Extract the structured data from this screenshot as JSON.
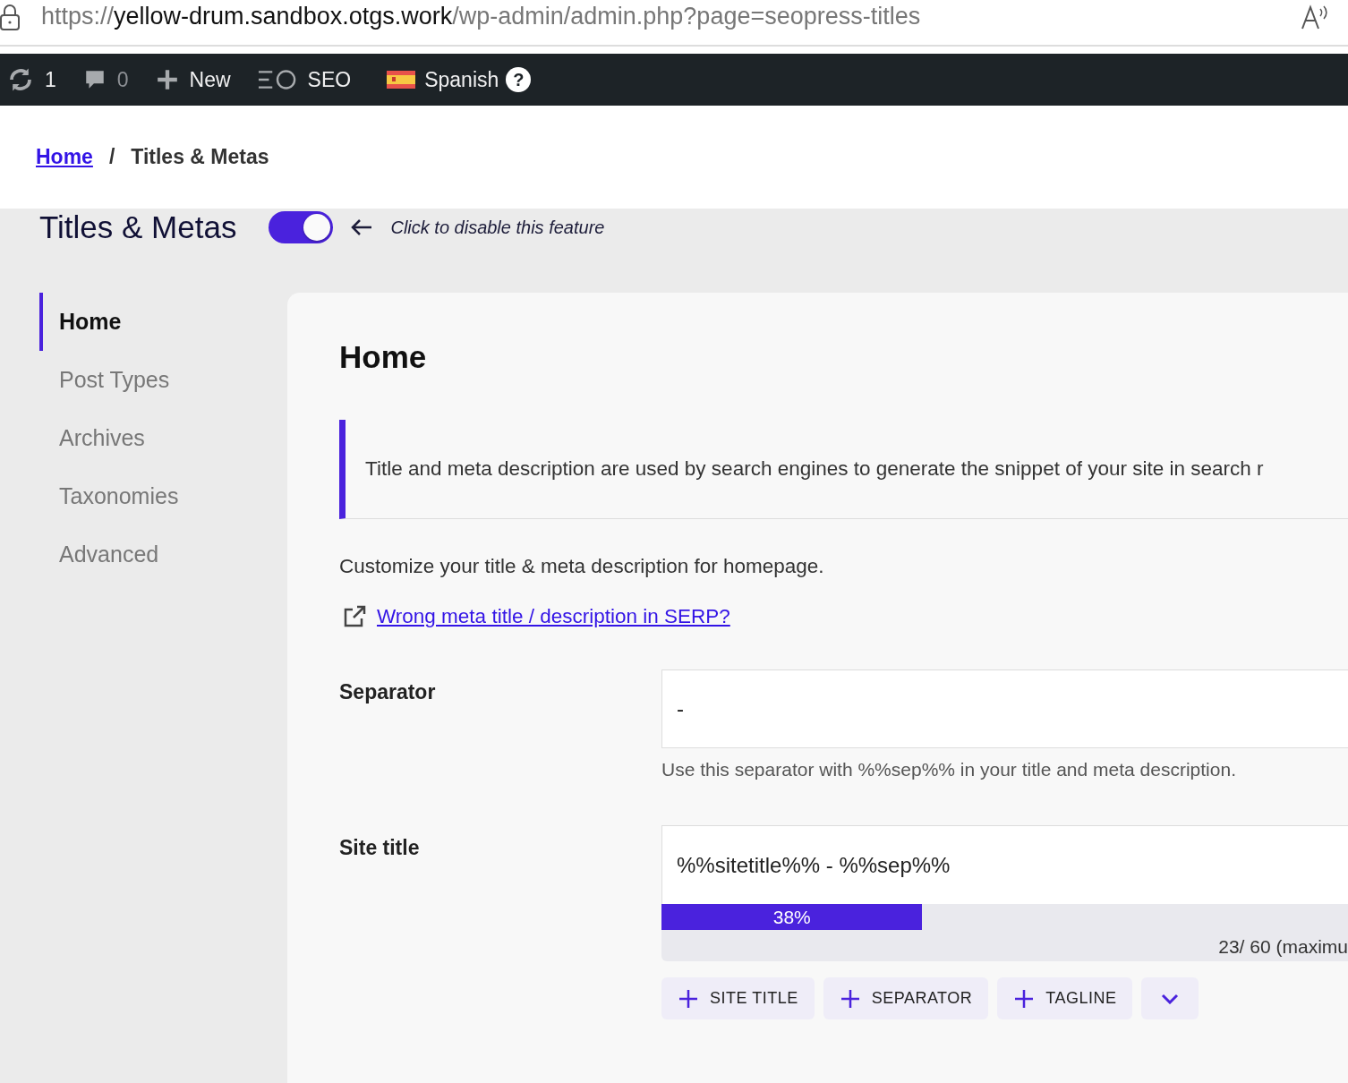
{
  "address_bar": {
    "scheme": "https://",
    "host": "yellow-drum.sandbox.otgs.work",
    "path": "/wp-admin/admin.php?page=seopress-titles"
  },
  "admin_bar": {
    "updates": "1",
    "comments": "0",
    "new": "New",
    "seo": "SEO",
    "language": "Spanish",
    "help": "?"
  },
  "breadcrumb": {
    "home": "Home",
    "separator": "/",
    "current": "Titles & Metas"
  },
  "header": {
    "title": "Titles & Metas",
    "toggle_on": true,
    "hint": "Click to disable this feature"
  },
  "sidebar": {
    "items": [
      {
        "label": "Home",
        "selected": true
      },
      {
        "label": "Post Types",
        "selected": false
      },
      {
        "label": "Archives",
        "selected": false
      },
      {
        "label": "Taxonomies",
        "selected": false
      },
      {
        "label": "Advanced",
        "selected": false
      }
    ]
  },
  "main": {
    "title": "Home",
    "notice": "Title and meta description are used by search engines to generate the snippet of your site in search r",
    "intro": "Customize your title & meta description for homepage.",
    "help_link": "Wrong meta title / description in SERP?",
    "fields": [
      {
        "kind": "separator",
        "label": "Separator",
        "value": "-",
        "help": "Use this separator with %%sep%% in your title and meta description."
      },
      {
        "kind": "title",
        "label": "Site title",
        "value": "%%sitetitle%% - %%sep%%",
        "level": 0.38,
        "percent": "38%",
        "counter": "23/ 60 (maximu",
        "tags": [
          "SITE TITLE",
          "SEPARATOR",
          "TAGLINE"
        ]
      }
    ]
  }
}
